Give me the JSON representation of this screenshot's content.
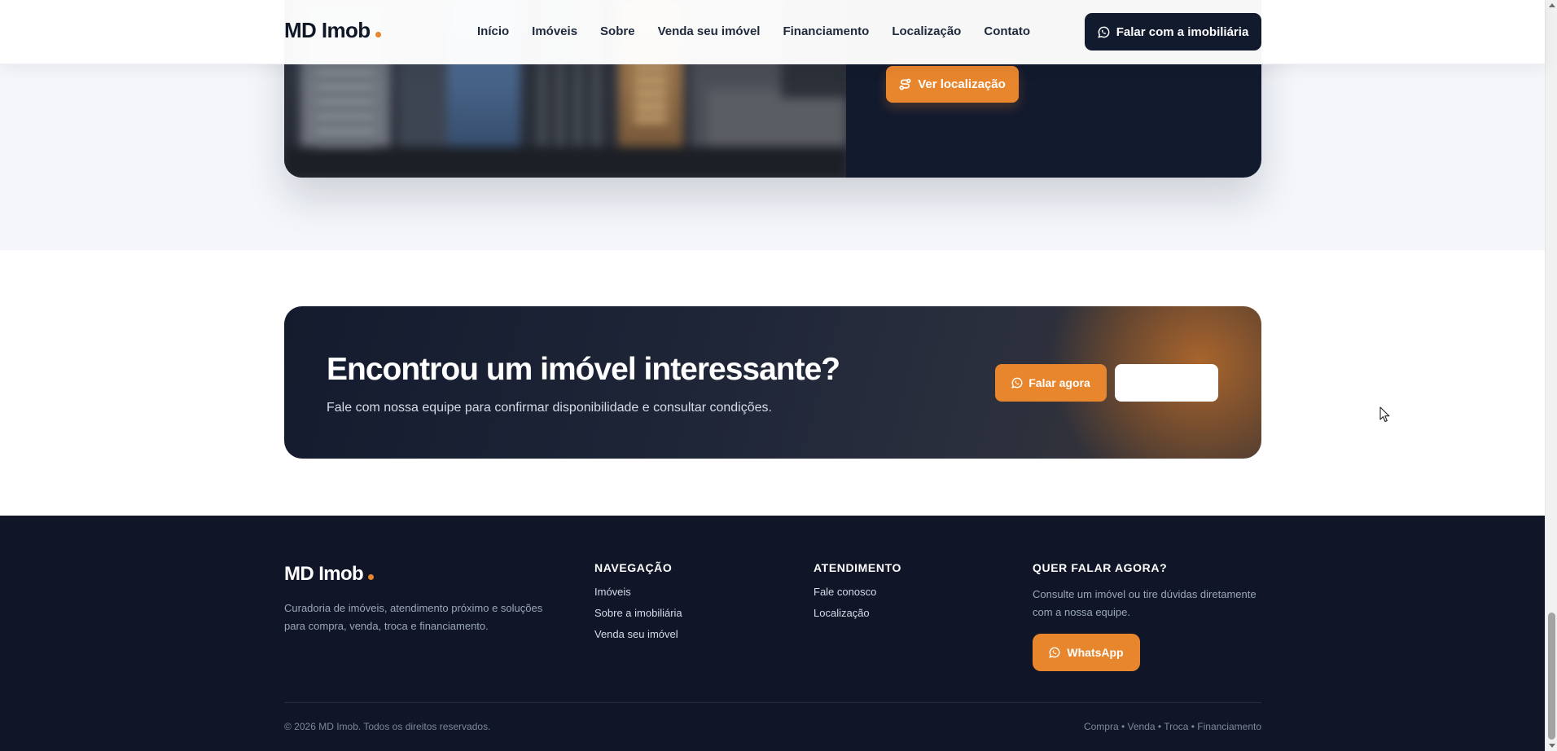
{
  "header": {
    "brand": "MD Imob",
    "nav": [
      "Início",
      "Imóveis",
      "Sobre",
      "Venda seu imóvel",
      "Financiamento",
      "Localização",
      "Contato"
    ],
    "cta_label": "Falar com a imobiliária"
  },
  "location_section": {
    "button_label": "Ver localização"
  },
  "cta_banner": {
    "title": "Encontrou um imóvel interessante?",
    "subtitle": "Fale com nossa equipe para confirmar disponibilidade e consultar condições.",
    "primary_label": "Falar agora",
    "secondary_label": ""
  },
  "footer": {
    "brand": "MD Imob",
    "description": "Curadoria de imóveis, atendimento próximo e soluções para compra, venda, troca e financiamento.",
    "columns": [
      {
        "title": "NAVEGAÇÃO",
        "links": [
          "Imóveis",
          "Sobre a imobiliária",
          "Venda seu imóvel"
        ]
      },
      {
        "title": "ATENDIMENTO",
        "links": [
          "Fale conosco",
          "Localização"
        ]
      }
    ],
    "contact": {
      "title": "QUER FALAR AGORA?",
      "text": "Consulte um imóvel ou tire dúvidas diretamente com a nossa equipe.",
      "button_label": "WhatsApp"
    },
    "copyright": "© 2026 MD Imob. Todos os direitos reservados.",
    "tags": "Compra • Venda • Troca • Financiamento"
  },
  "colors": {
    "accent": "#e8862e",
    "navy": "#121a2e",
    "footer_bg": "#101628",
    "section_bg": "#f4f6fa"
  },
  "icons": {
    "whatsapp": "whatsapp-icon",
    "route": "route-icon",
    "cursor": "mouse-cursor-icon"
  }
}
